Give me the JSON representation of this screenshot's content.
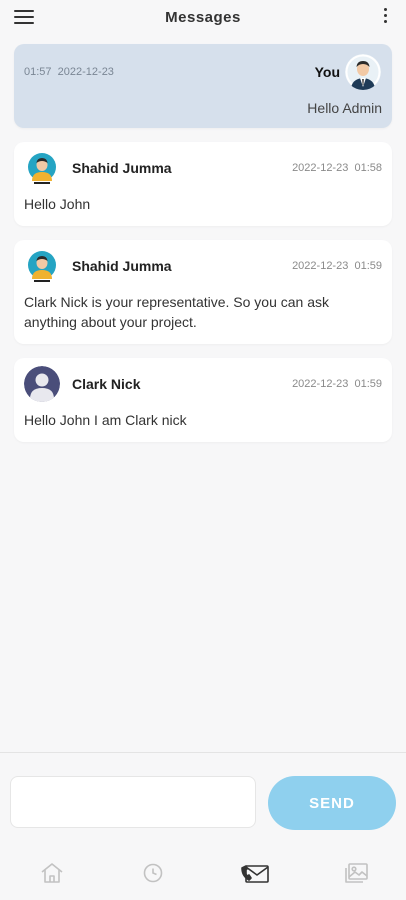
{
  "header": {
    "title": "Messages",
    "menu_icon": "hamburger-icon",
    "more_icon": "more-vertical-icon"
  },
  "messages": [
    {
      "time": "01:57",
      "date": "2022-12-23",
      "sender": "You",
      "text": "Hello Admin",
      "avatar": "avatar-man-suit"
    },
    {
      "sender": "Shahid Jumma",
      "date": "2022-12-23",
      "time": "01:58",
      "text": "Hello John",
      "avatar": "avatar-person-cyan"
    },
    {
      "sender": "Shahid Jumma",
      "date": "2022-12-23",
      "time": "01:59",
      "text": "Clark Nick is your representative. So you can ask anything about your project.",
      "avatar": "avatar-person-cyan"
    },
    {
      "sender": "Clark Nick",
      "date": "2022-12-23",
      "time": "01:59",
      "text": "Hello John I am Clark nick",
      "avatar": "avatar-placeholder"
    }
  ],
  "composer": {
    "input_value": "",
    "placeholder": "",
    "send_label": "SEND"
  },
  "nav": [
    {
      "icon": "home-icon",
      "active": false
    },
    {
      "icon": "clock-icon",
      "active": false
    },
    {
      "icon": "mail-phone-icon",
      "active": true
    },
    {
      "icon": "gallery-icon",
      "active": false
    }
  ],
  "colors": {
    "my_bubble": "#d6e0ec",
    "send_button": "#8fd0ee",
    "background": "#f7f7f8"
  }
}
